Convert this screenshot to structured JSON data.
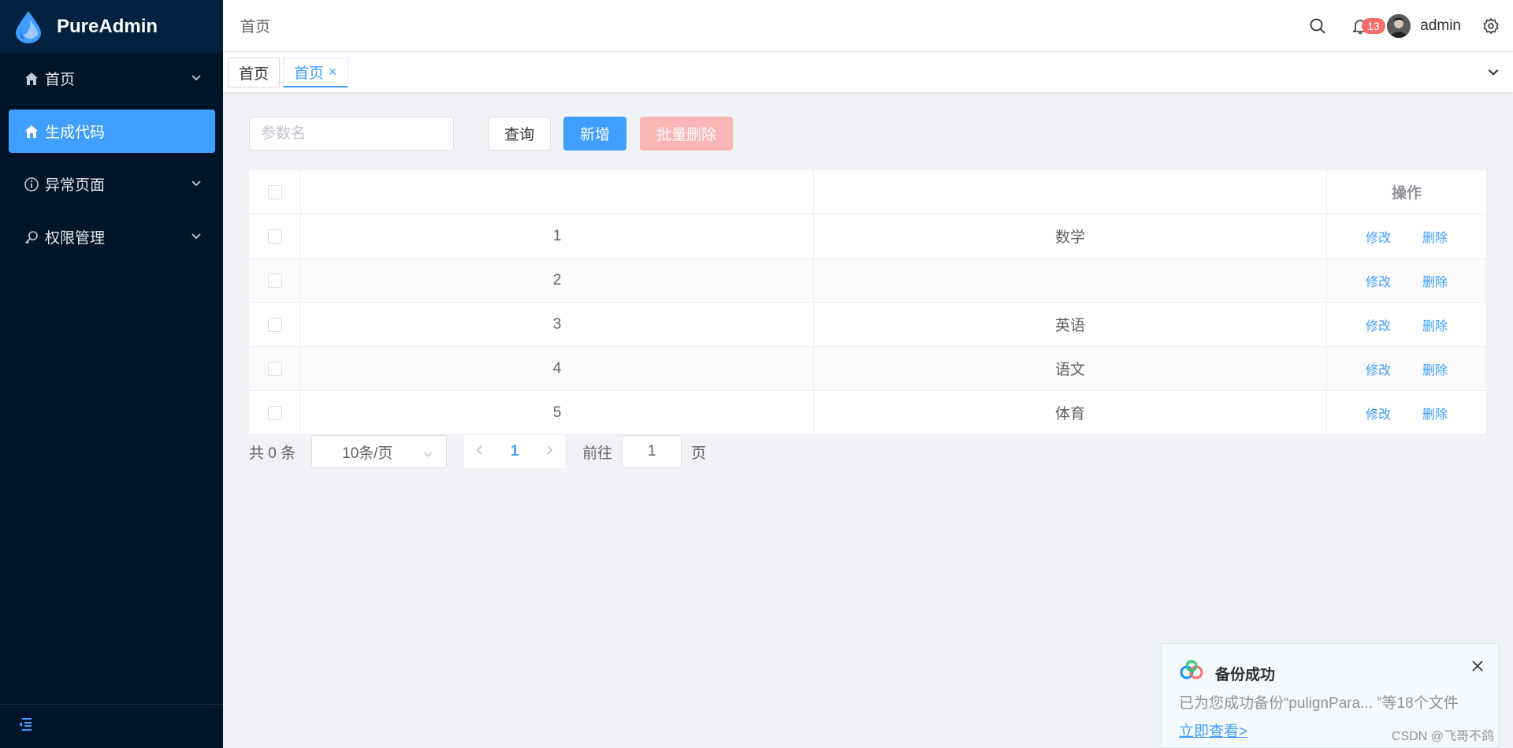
{
  "app": {
    "name": "PureAdmin"
  },
  "sidebar": {
    "items": [
      {
        "label": "首页",
        "icon": "home-icon",
        "expandable": true
      },
      {
        "label": "生成代码",
        "icon": "home-icon",
        "active": true
      },
      {
        "label": "异常页面",
        "icon": "info-icon",
        "expandable": true
      },
      {
        "label": "权限管理",
        "icon": "key-icon",
        "expandable": true
      }
    ],
    "collapse_icon": "menu-fold-icon"
  },
  "header": {
    "breadcrumb": "首页",
    "notification_count": "13",
    "username": "admin"
  },
  "tags": [
    {
      "label": "首页"
    },
    {
      "label": "首页",
      "active": true,
      "close": "×"
    }
  ],
  "toolbar": {
    "search_placeholder": "参数名",
    "query_label": "查询",
    "add_label": "新增",
    "batch_delete_label": "批量删除"
  },
  "table": {
    "headers": {
      "id": "",
      "name": "",
      "op": "操作"
    },
    "rows": [
      {
        "id": "1",
        "name": "数学",
        "edit": "修改",
        "delete": "删除"
      },
      {
        "id": "2",
        "name": "",
        "edit": "修改",
        "delete": "删除"
      },
      {
        "id": "3",
        "name": "英语",
        "edit": "修改",
        "delete": "删除"
      },
      {
        "id": "4",
        "name": "语文",
        "edit": "修改",
        "delete": "删除"
      },
      {
        "id": "5",
        "name": "体育",
        "edit": "修改",
        "delete": "删除"
      }
    ]
  },
  "pagination": {
    "total": "共 0 条",
    "page_size": "10条/页",
    "current_page": "1",
    "goto_label": "前往",
    "goto_value": "1",
    "page_unit": "页"
  },
  "toast": {
    "title": "备份成功",
    "body": "已为您成功备份“pulignPara...  ”等18个文件",
    "link": "立即查看>"
  },
  "watermark": "CSDN @飞哥不鸽",
  "colors": {
    "primary": "#409eff",
    "sidebar": "#001529",
    "danger_light": "#fab6b6",
    "badge": "#f56c6c"
  }
}
